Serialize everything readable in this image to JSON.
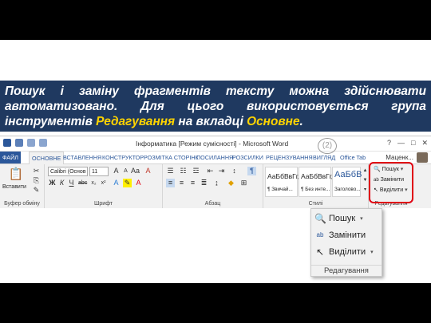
{
  "caption": {
    "part1": "Пошук і заміну фрагментів тексту можна здійснювати автоматизовано. Для цього використовується група інструментів ",
    "hl1": "Редагування",
    "part2": " на вкладці ",
    "hl2": "Основне",
    "part3": "."
  },
  "window": {
    "title": "Інформатика [Режим сумісності] - Microsoft Word",
    "controls": [
      "?",
      "—",
      "□",
      "✕"
    ]
  },
  "tabs": [
    "ФАЙЛ",
    "ОСНОВНЕ",
    "ВСТАВЛЕННЯ",
    "КОНСТРУКТОР",
    "РОЗМІТКА СТОРІНК",
    "ПОСИЛАННЯ",
    "РОЗСИЛКИ",
    "РЕЦЕНЗУВАННЯ",
    "ВИГЛЯД",
    "Office Tab"
  ],
  "user": "Маценк...",
  "ribbon": {
    "clipboard": {
      "paste": "Вставити",
      "label": "Буфер обміну"
    },
    "font": {
      "name": "Calibri (Основ",
      "size": "11",
      "label": "Шрифт"
    },
    "paragraph": {
      "label": "Абзац"
    },
    "styles": {
      "items": [
        {
          "sample": "АаБбВвГг,",
          "name": "¶ Звичай..."
        },
        {
          "sample": "АаБбВвГг,",
          "name": "¶ Без инте..."
        },
        {
          "sample": "АаБбВ",
          "name": "Заголово..."
        }
      ],
      "label": "Стилі"
    },
    "editing": {
      "find": "Пошук",
      "replace": "Замінити",
      "select": "Виділити",
      "label": "Редагування"
    }
  },
  "zoom_panel": {
    "find": "Пошук",
    "replace": "Замінити",
    "select": "Виділити",
    "label": "Редагування"
  },
  "callout_number": "(2)"
}
